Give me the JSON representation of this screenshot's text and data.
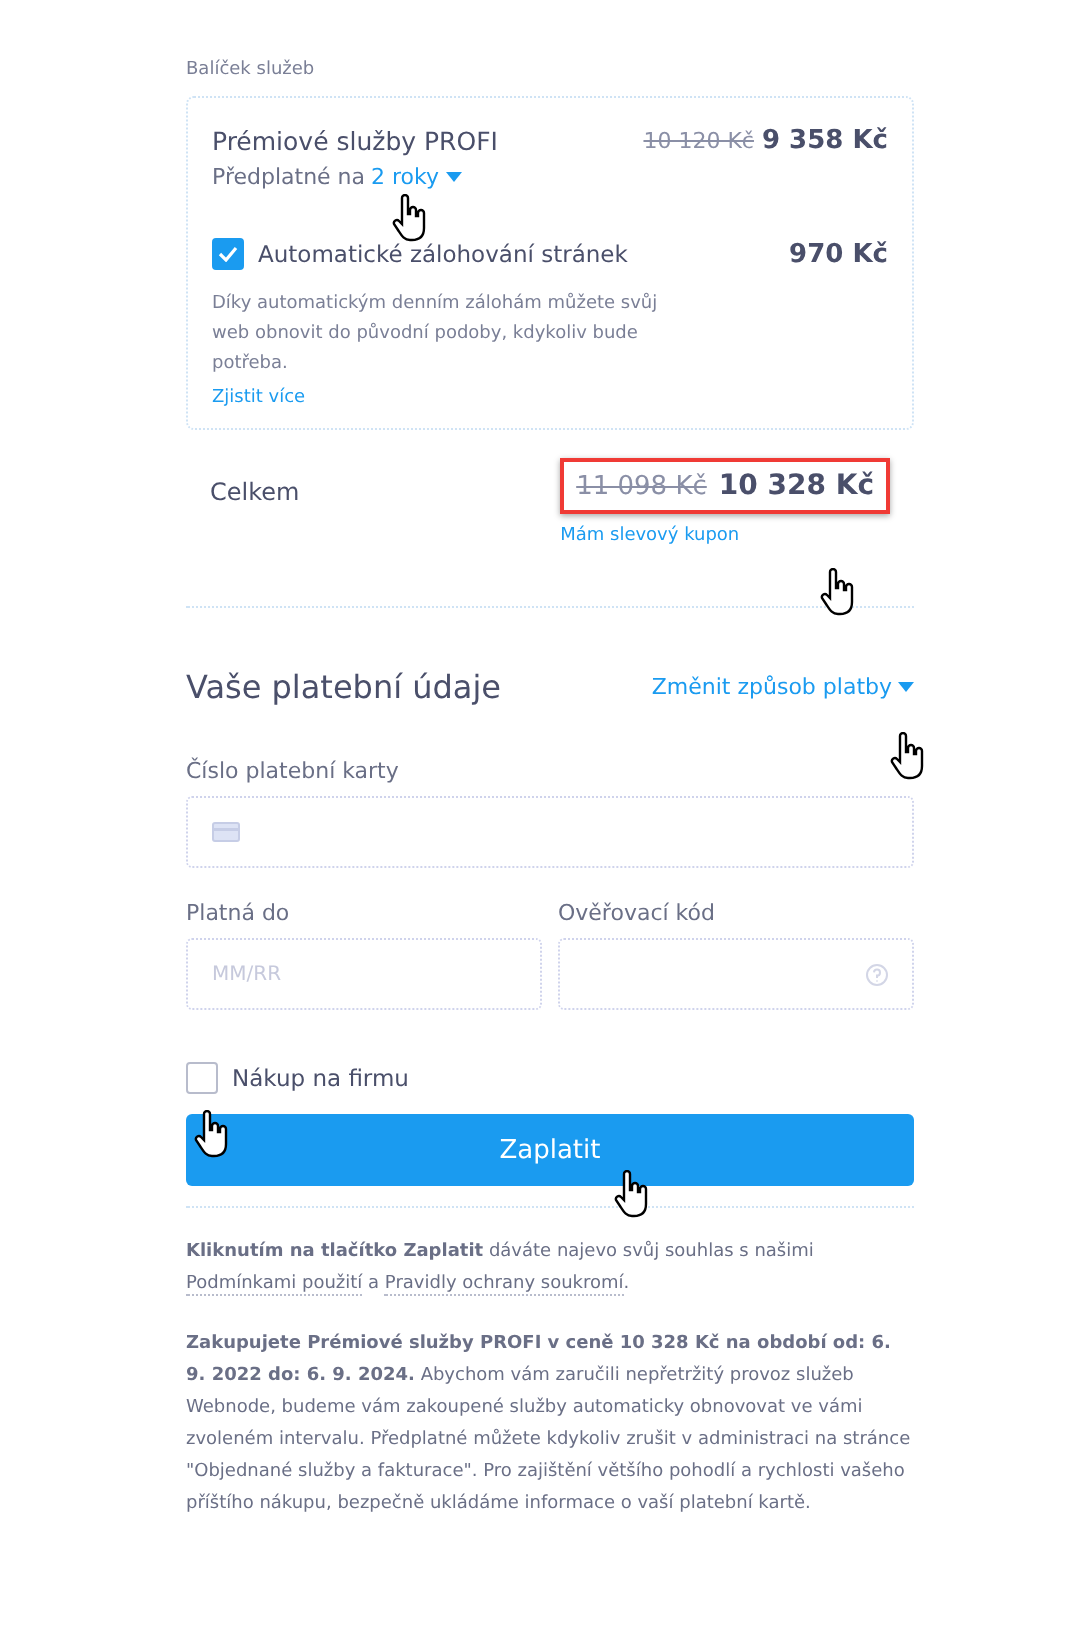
{
  "package": {
    "label": "Balíček služeb",
    "name": "Prémiové služby PROFI",
    "old_price": "10 120 Kč",
    "price": "9 358 Kč",
    "subscription_prefix": "Předplatné na",
    "subscription_period": "2 roky",
    "addon": {
      "label": "Automatické zálohování stránek",
      "checked": true,
      "price": "970 Kč",
      "description": "Díky automatickým denním zálohám můžete svůj web obnovit do původní podoby, kdykoliv bude potřeba.",
      "link": "Zjistit více"
    }
  },
  "total": {
    "label": "Celkem",
    "old_price": "11 098 Kč",
    "price": "10 328 Kč",
    "highlighted": true,
    "coupon_link": "Mám slevový kupon"
  },
  "payment": {
    "title": "Vaše platební údaje",
    "change_link": "Změnit způsob platby",
    "card_label": "Číslo platební karty",
    "expiry_label": "Platná do",
    "expiry_placeholder": "MM/RR",
    "cvc_label": "Ověřovací kód",
    "company": {
      "label": "Nákup na firmu",
      "checked": false
    },
    "pay_button": "Zaplatit"
  },
  "legal": [
    {
      "kind": "bold",
      "text": "Kliknutím na tlačítko Zaplatit"
    },
    {
      "kind": "plain",
      "text": " dáváte najevo svůj souhlas s našimi "
    },
    {
      "kind": "link",
      "text": "Podmínkami použití"
    },
    {
      "kind": "plain",
      "text": " a "
    },
    {
      "kind": "link",
      "text": "Pravidly ochrany soukromí"
    },
    {
      "kind": "plain",
      "text": "."
    }
  ],
  "summary": "**Zakupujete Prémiové služby PROFI v ceně 10 328 Kč na období od: 6. 9. 2022 do: 6. 9. 2024.** Abychom vám zaručili nepřetržitý provoz služeb Webnode, budeme vám zakoupené služby automaticky obnovovat ve vámi zvoleném intervalu. Předplatné můžete kdykoliv zrušit v administraci na stránce \"Objednané služby a fakturace\". Pro zajištění většího pohodlí a rychlosti vašeho příštího nákupu, bezpečně ukládáme informace o vaší platební kartě."
}
